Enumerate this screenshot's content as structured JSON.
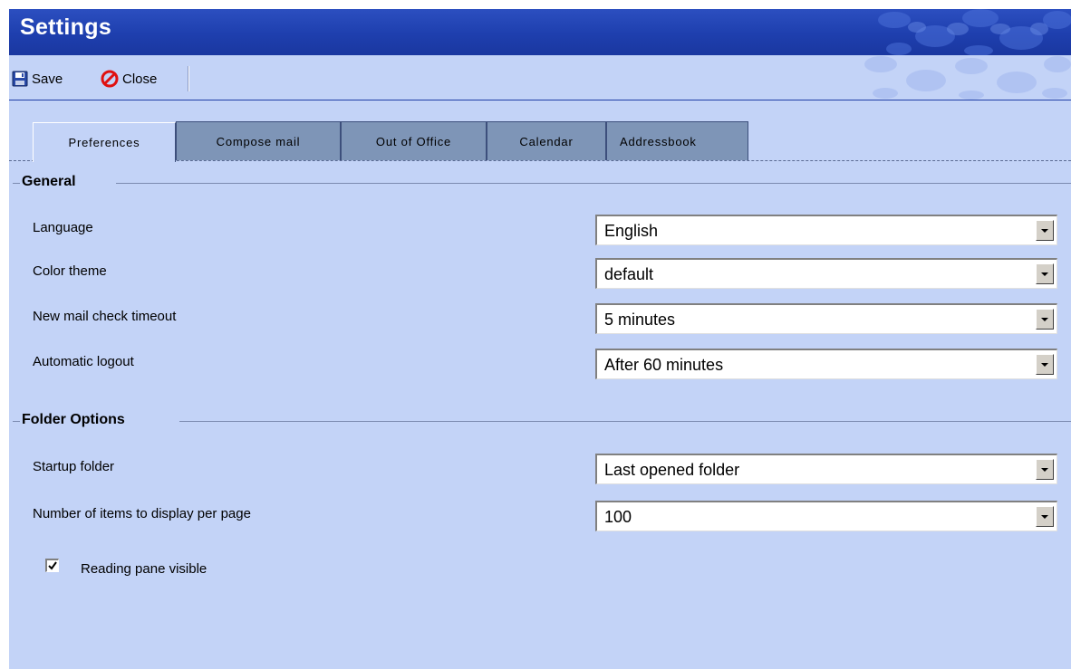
{
  "window": {
    "title": "Settings"
  },
  "toolbar": {
    "save_label": "Save",
    "close_label": "Close"
  },
  "tabs": [
    {
      "label": "Preferences",
      "active": true
    },
    {
      "label": "Compose mail",
      "active": false
    },
    {
      "label": "Out of Office",
      "active": false
    },
    {
      "label": "Calendar",
      "active": false
    },
    {
      "label": "Addressbook",
      "active": false
    }
  ],
  "general": {
    "legend": "General",
    "rows": [
      {
        "label": "Language",
        "value": "English"
      },
      {
        "label": "Color theme",
        "value": "default"
      },
      {
        "label": "New mail check timeout",
        "value": "5 minutes"
      },
      {
        "label": "Automatic logout",
        "value": "After 60 minutes"
      }
    ]
  },
  "folder_options": {
    "legend": "Folder Options",
    "rows": [
      {
        "label": "Startup folder",
        "value": "Last opened folder"
      },
      {
        "label": "Number of items to display per page",
        "value": "100"
      }
    ],
    "reading_pane": {
      "label": "Reading pane visible",
      "checked": true
    }
  },
  "icons": {
    "save": "floppy-disk-icon",
    "close": "no-entry-icon",
    "dropdown": "chevron-down-icon",
    "check": "check-icon"
  },
  "colors": {
    "titlebar": "#1e3fae",
    "panel": "#c3d3f7",
    "inactive_tab": "#7e95b7"
  }
}
